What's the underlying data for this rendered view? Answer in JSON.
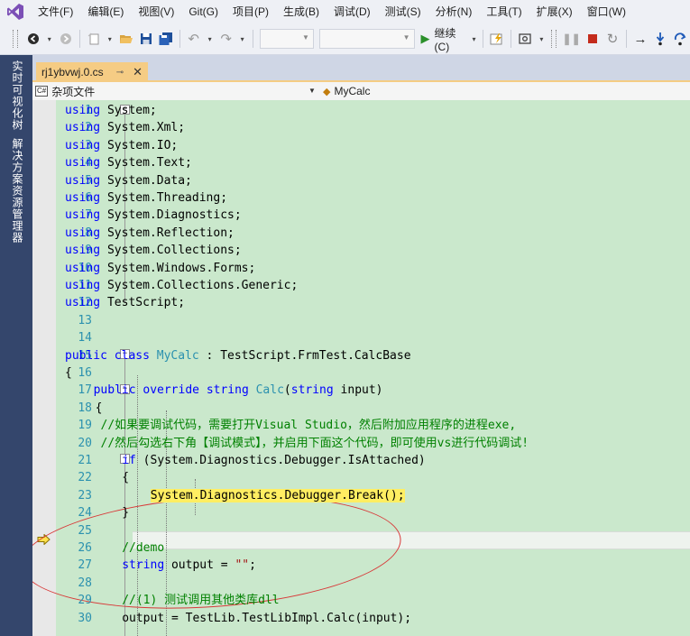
{
  "menu": {
    "items": [
      "文件(F)",
      "编辑(E)",
      "视图(V)",
      "Git(G)",
      "项目(P)",
      "生成(B)",
      "调试(D)",
      "测试(S)",
      "分析(N)",
      "工具(T)",
      "扩展(X)",
      "窗口(W)"
    ]
  },
  "toolbar": {
    "continue_label": "继续(C)"
  },
  "sidebar": {
    "tabs": [
      "实时可视化树",
      "解决方案资源管理器"
    ]
  },
  "document_tab": {
    "title": "rj1ybvwj.0.cs",
    "pin_glyph": "⊸",
    "close_glyph": "✕"
  },
  "navbar": {
    "project": "杂项文件",
    "project_icon_text": "C#",
    "member": "MyCalc"
  },
  "editor": {
    "lines": [
      {
        "n": "1",
        "tokens": [
          [
            "kw",
            "using"
          ],
          [
            "",
            "System;"
          ]
        ]
      },
      {
        "n": "2",
        "tokens": [
          [
            "kw",
            "using"
          ],
          [
            "",
            "System.Xml;"
          ]
        ]
      },
      {
        "n": "3",
        "tokens": [
          [
            "kw",
            "using"
          ],
          [
            "",
            "System.IO;"
          ]
        ]
      },
      {
        "n": "4",
        "tokens": [
          [
            "kw",
            "using"
          ],
          [
            "",
            "System.Text;"
          ]
        ]
      },
      {
        "n": "5",
        "tokens": [
          [
            "kw",
            "using"
          ],
          [
            "",
            "System.Data;"
          ]
        ]
      },
      {
        "n": "6",
        "tokens": [
          [
            "kw",
            "using"
          ],
          [
            "",
            "System.Threading;"
          ]
        ]
      },
      {
        "n": "7",
        "tokens": [
          [
            "kw",
            "using"
          ],
          [
            "",
            "System.Diagnostics;"
          ]
        ]
      },
      {
        "n": "8",
        "tokens": [
          [
            "kw",
            "using"
          ],
          [
            "",
            "System.Reflection;"
          ]
        ]
      },
      {
        "n": "9",
        "tokens": [
          [
            "kw",
            "using"
          ],
          [
            "",
            "System.Collections;"
          ]
        ]
      },
      {
        "n": "10",
        "tokens": [
          [
            "kw",
            "using"
          ],
          [
            "",
            "System.Windows.Forms;"
          ]
        ]
      },
      {
        "n": "11",
        "tokens": [
          [
            "kw",
            "using"
          ],
          [
            "",
            "System.Collections.Generic;"
          ]
        ]
      },
      {
        "n": "12",
        "tokens": [
          [
            "kw",
            "using"
          ],
          [
            "",
            "TestScript;"
          ]
        ]
      },
      {
        "n": "13",
        "tokens": []
      },
      {
        "n": "14",
        "tokens": []
      },
      {
        "n": "15",
        "tokens": [
          [
            "kw",
            "public class"
          ],
          [
            "ty",
            "MyCalc"
          ],
          [
            "",
            ": TestScript.FrmTest.CalcBase"
          ]
        ]
      },
      {
        "n": "16",
        "tokens": [
          [
            "",
            "{"
          ]
        ]
      },
      {
        "n": "17",
        "tokens": [
          [
            "kw",
            "public override string"
          ],
          [
            "ty",
            "Calc"
          ],
          [
            "",
            "("
          ],
          [
            "kw",
            "string"
          ],
          [
            "",
            "input)"
          ]
        ]
      },
      {
        "n": "18",
        "tokens": [
          [
            "",
            "{"
          ]
        ]
      },
      {
        "n": "19",
        "tokens": [
          [
            "cm",
            "//如果要调试代码，需要打开Visual Studio，然后附加应用程序的进程exe,"
          ]
        ]
      },
      {
        "n": "20",
        "tokens": [
          [
            "cm",
            "//然后勾选右下角【调试模式】，并启用下面这个代码，即可使用vs进行代码调试!"
          ]
        ]
      },
      {
        "n": "21",
        "tokens": [
          [
            "kw",
            "if"
          ],
          [
            "",
            "(System.Diagnostics.Debugger.IsAttached)"
          ]
        ]
      },
      {
        "n": "22",
        "tokens": [
          [
            "",
            "{"
          ]
        ]
      },
      {
        "n": "23",
        "tokens": [
          [
            "",
            "System.Diagnostics.Debugger.Break();"
          ]
        ]
      },
      {
        "n": "24",
        "tokens": [
          [
            "",
            "}"
          ]
        ]
      },
      {
        "n": "25",
        "tokens": []
      },
      {
        "n": "26",
        "tokens": [
          [
            "cm",
            "//demo"
          ]
        ]
      },
      {
        "n": "27",
        "tokens": [
          [
            "kw",
            "string"
          ],
          [
            "",
            "output = "
          ],
          [
            "st",
            "\"\""
          ],
          [
            "",
            ";"
          ]
        ]
      },
      {
        "n": "28",
        "tokens": []
      },
      {
        "n": "29",
        "tokens": [
          [
            "cm",
            "//(1) 测试调用其他类库dll"
          ]
        ]
      },
      {
        "n": "30",
        "tokens": [
          [
            "",
            "output = TestLib.TestLibImpl.Calc(input);"
          ]
        ]
      }
    ]
  }
}
